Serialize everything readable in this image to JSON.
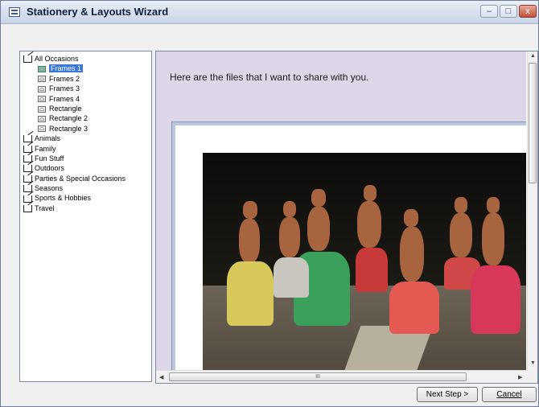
{
  "window": {
    "title": "Stationery & Layouts Wizard",
    "controls": {
      "minimize": "–",
      "maximize": "□",
      "close": "x"
    }
  },
  "tree": {
    "items": [
      {
        "label": "All Occasions",
        "level": 0,
        "icon": "category-icon"
      },
      {
        "label": "Frames 1",
        "level": 1,
        "icon": "layout-icon",
        "selected": true
      },
      {
        "label": "Frames 2",
        "level": 1,
        "icon": "layout-icon"
      },
      {
        "label": "Frames 3",
        "level": 1,
        "icon": "layout-icon"
      },
      {
        "label": "Frames 4",
        "level": 1,
        "icon": "layout-icon"
      },
      {
        "label": "Rectangle",
        "level": 1,
        "icon": "layout-icon"
      },
      {
        "label": "Rectangle 2",
        "level": 1,
        "icon": "layout-icon"
      },
      {
        "label": "Rectangle 3",
        "level": 1,
        "icon": "layout-icon"
      },
      {
        "label": "Animals",
        "level": 0,
        "icon": "category-icon"
      },
      {
        "label": "Family",
        "level": 0,
        "icon": "category-icon"
      },
      {
        "label": "Fun Stuff",
        "level": 0,
        "icon": "category-icon"
      },
      {
        "label": "Outdoors",
        "level": 0,
        "icon": "category-icon"
      },
      {
        "label": "Parties & Special Occasions",
        "level": 0,
        "icon": "category-icon"
      },
      {
        "label": "Seasons",
        "level": 0,
        "icon": "category-icon"
      },
      {
        "label": "Sports & Hobbies",
        "level": 0,
        "icon": "category-icon"
      },
      {
        "label": "Travel",
        "level": 0,
        "icon": "category-icon"
      }
    ]
  },
  "preview": {
    "message": "Here are the files that I want to share with you.",
    "hscroll_grip": "III"
  },
  "buttons": {
    "next": "Next Step >",
    "cancel": "Cancel"
  },
  "colors": {
    "selection": "#3a77d8",
    "preview_background": "#dcd6e8",
    "frame_border": "#bac6df"
  }
}
